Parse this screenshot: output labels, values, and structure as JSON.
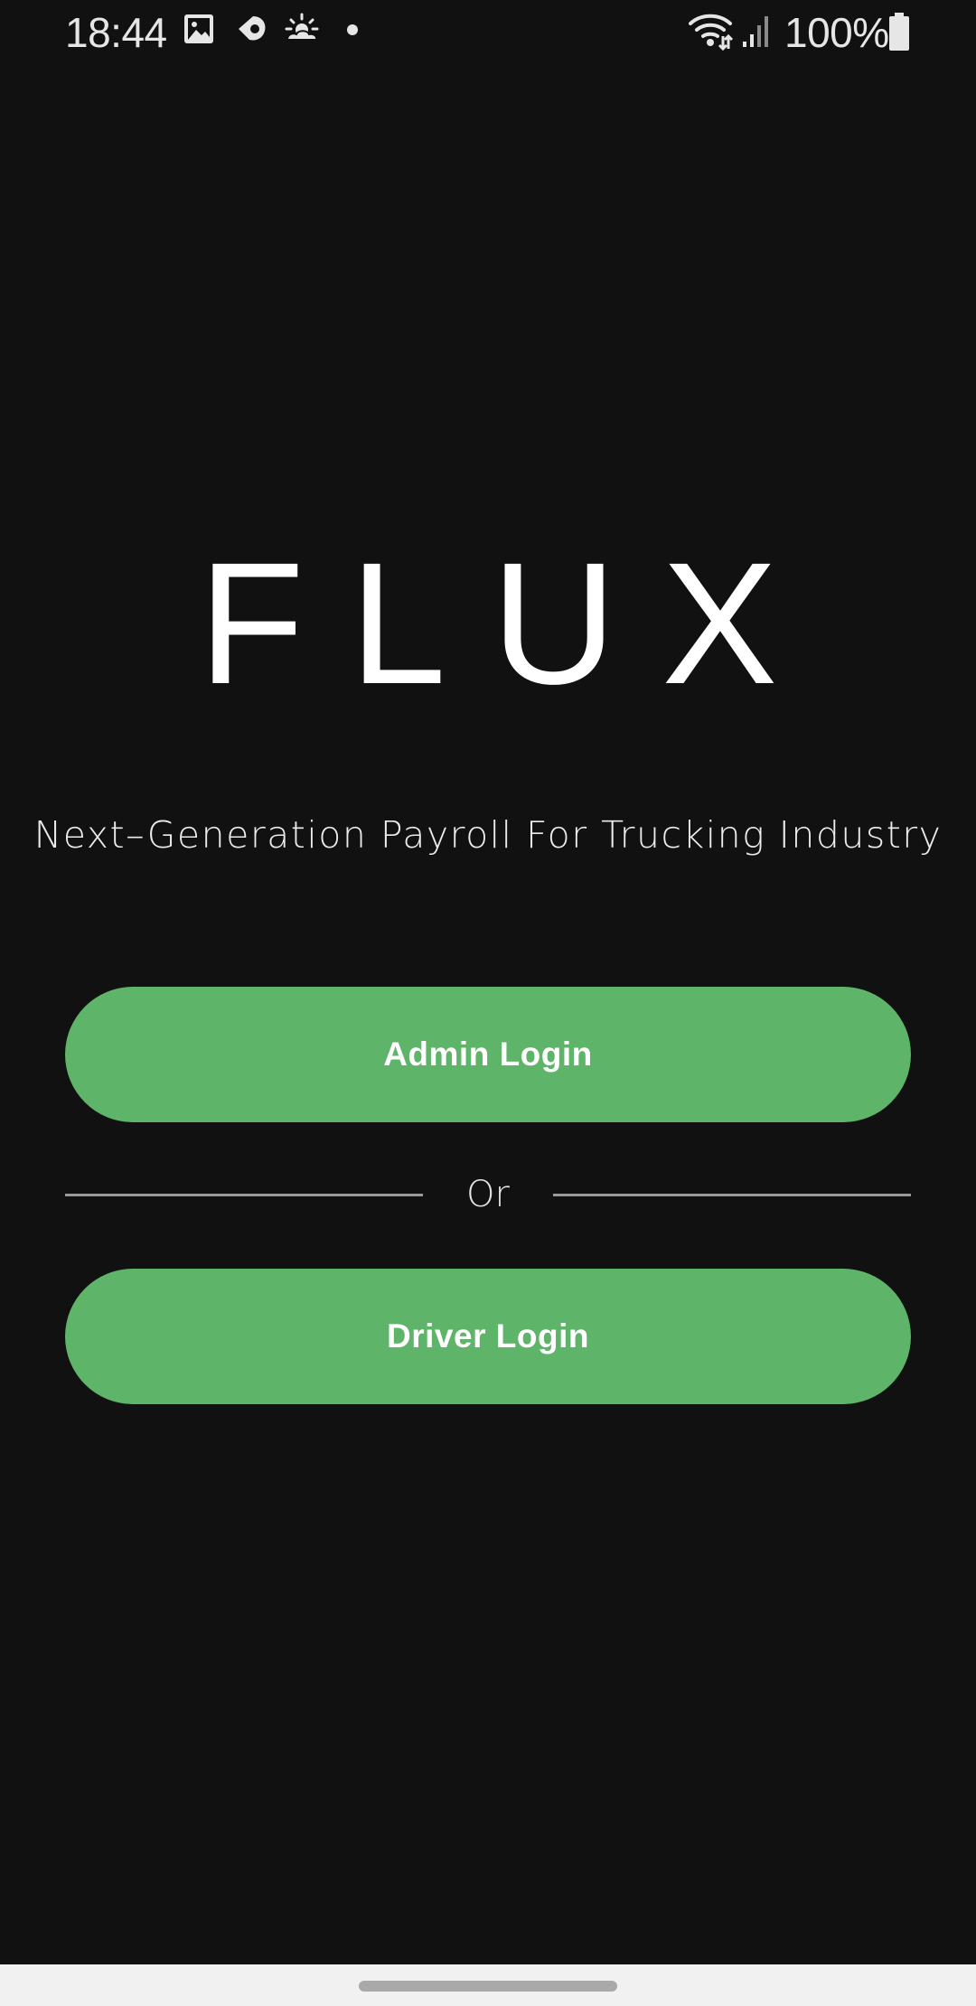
{
  "status_bar": {
    "time": "18:44",
    "battery_percent": "100%",
    "icons": [
      "gallery-icon",
      "cloud-icon",
      "weather-icon",
      "dot-icon",
      "wifi-icon",
      "signal-icon",
      "battery-icon"
    ]
  },
  "app": {
    "logo": "FLUX",
    "tagline": "Next–Generation Payroll For Trucking Industry"
  },
  "buttons": {
    "admin_login": "Admin Login",
    "driver_login": "Driver Login"
  },
  "divider": {
    "text": "Or"
  },
  "colors": {
    "background": "#111111",
    "button": "#5eb469",
    "text": "#ffffff"
  }
}
